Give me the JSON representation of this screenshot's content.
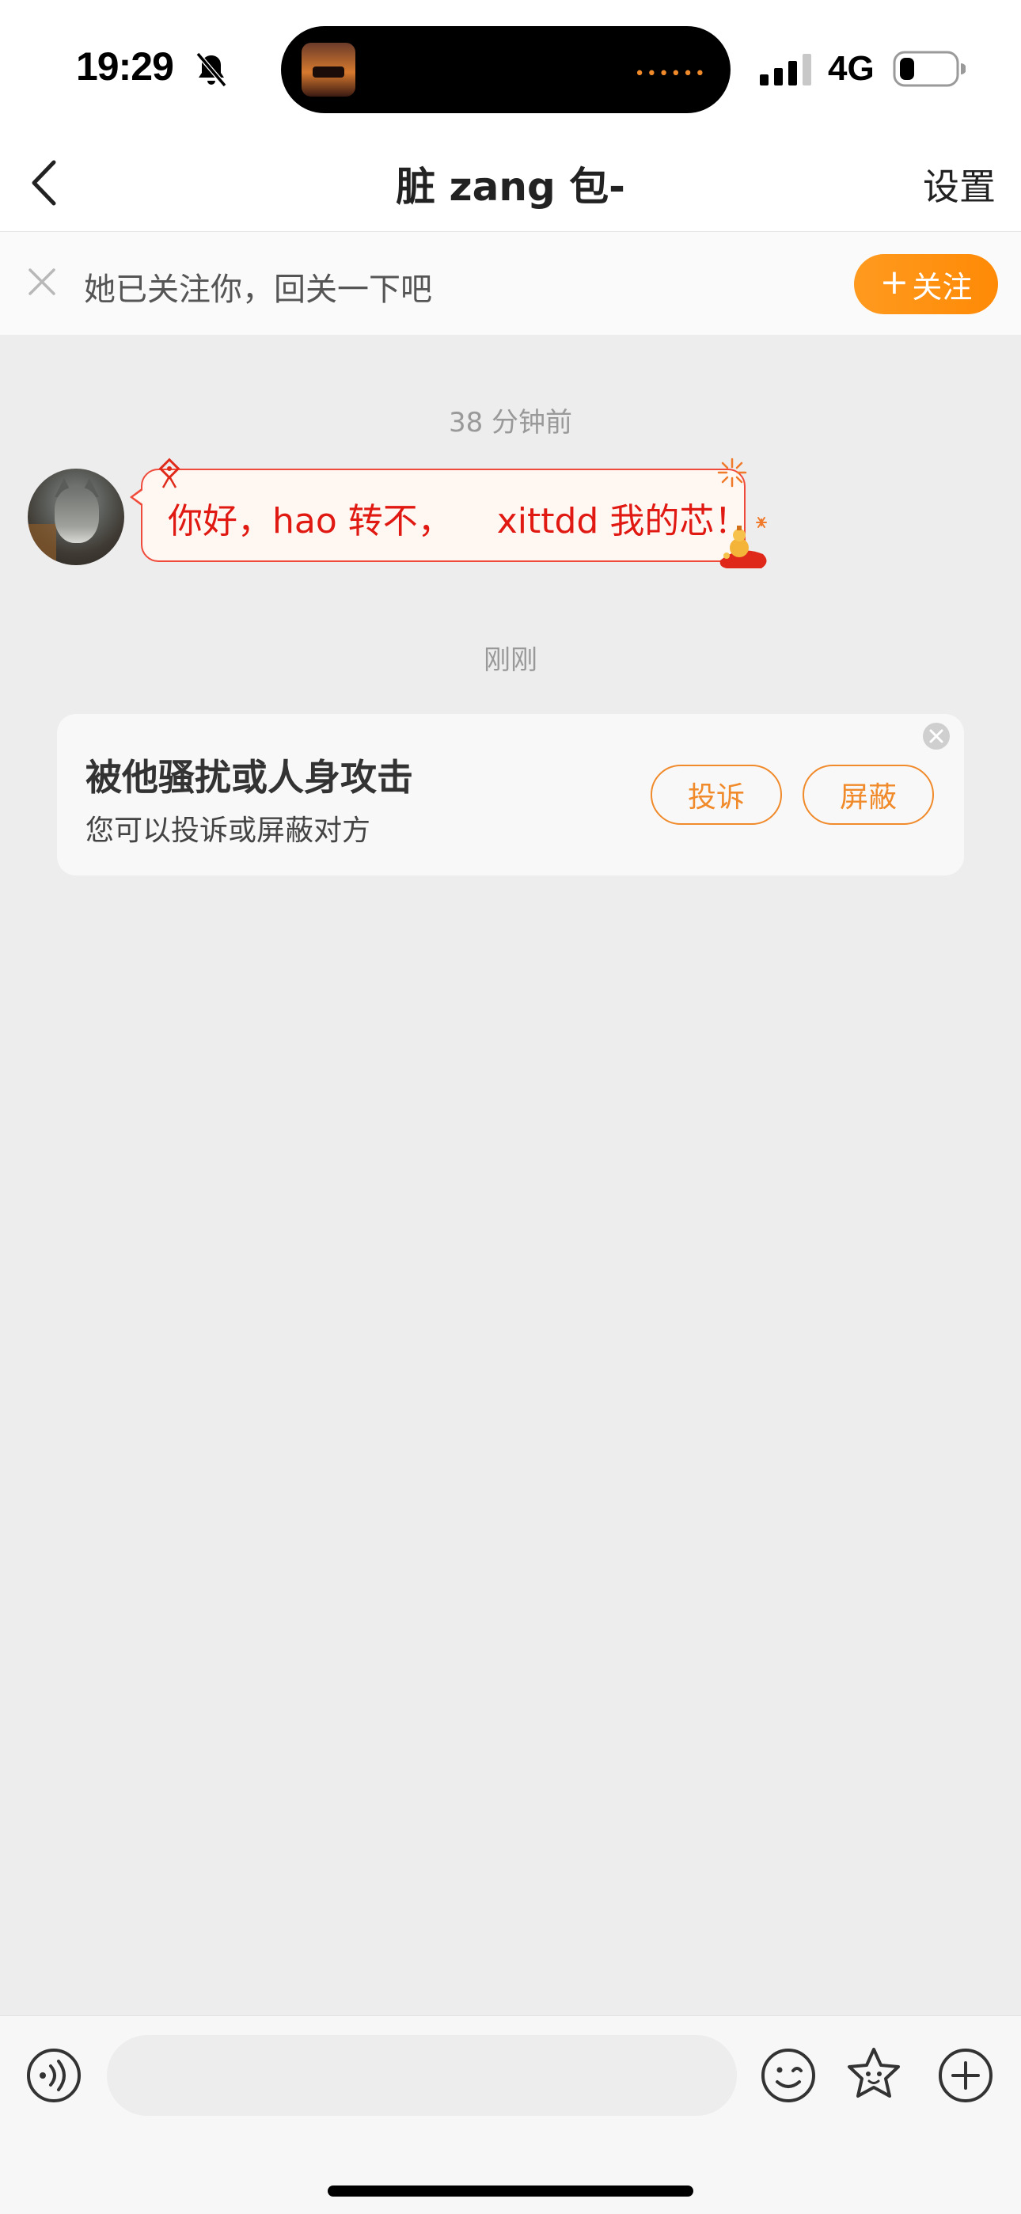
{
  "status_bar": {
    "time": "19:29",
    "network": "4G"
  },
  "nav": {
    "title": "脏 zang 包-",
    "settings_label": "设置"
  },
  "follow_banner": {
    "text": "她已关注你，回关一下吧",
    "follow_plus": "+",
    "follow_label": "关注"
  },
  "chat": {
    "timestamp_1": "38 分钟前",
    "message_1": "你好，hao 转不，    xittdd 我的芯！",
    "timestamp_2": "刚刚"
  },
  "report_card": {
    "title": "被他骚扰或人身攻击",
    "subtitle": "您可以投诉或屏蔽对方",
    "report_label": "投诉",
    "block_label": "屏蔽"
  },
  "input_bar": {
    "placeholder": ""
  },
  "colors": {
    "accent": "#ff9a1f",
    "bubble_text": "#e01a12",
    "bubble_border": "#f04a3a",
    "background": "#ededed"
  }
}
